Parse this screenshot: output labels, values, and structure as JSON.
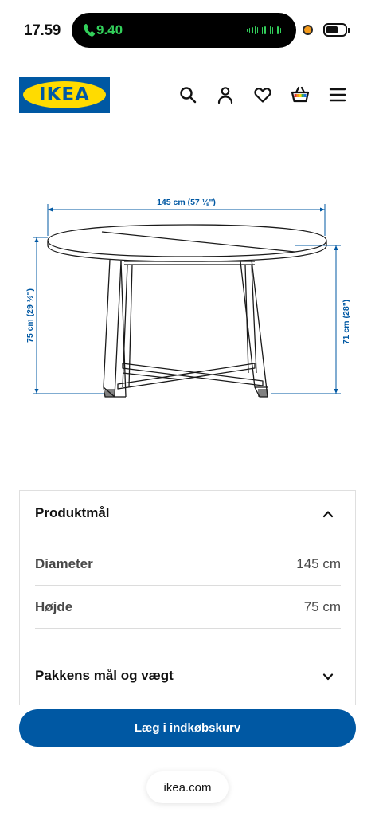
{
  "status_bar": {
    "time": "17.59",
    "call_timer": "9.40",
    "call_color": "#33d05b",
    "recording_dot_color": "#f39a1b",
    "battery_level": 0.65
  },
  "header": {
    "logo_text": "IKEA",
    "brand_blue": "#0058a3",
    "brand_yellow": "#ffdb00",
    "icons": [
      "search-icon",
      "account-icon",
      "heart-icon",
      "basket-icon",
      "menu-icon"
    ]
  },
  "illustration": {
    "width_label": "145 cm (57 ⅛\")",
    "height_label": "75 cm (29 ½\")",
    "leg_height_label": "71 cm (28\")"
  },
  "dimensions_section": {
    "title": "Produktmål",
    "expanded": true,
    "rows": [
      {
        "label": "Diameter",
        "value": "145 cm"
      },
      {
        "label": "Højde",
        "value": "75 cm"
      }
    ]
  },
  "package_section": {
    "title": "Pakkens mål og vægt",
    "expanded": false
  },
  "cta": {
    "label": "Læg i indkøbskurv",
    "color": "#0058a3"
  },
  "browser": {
    "domain": "ikea.com"
  }
}
